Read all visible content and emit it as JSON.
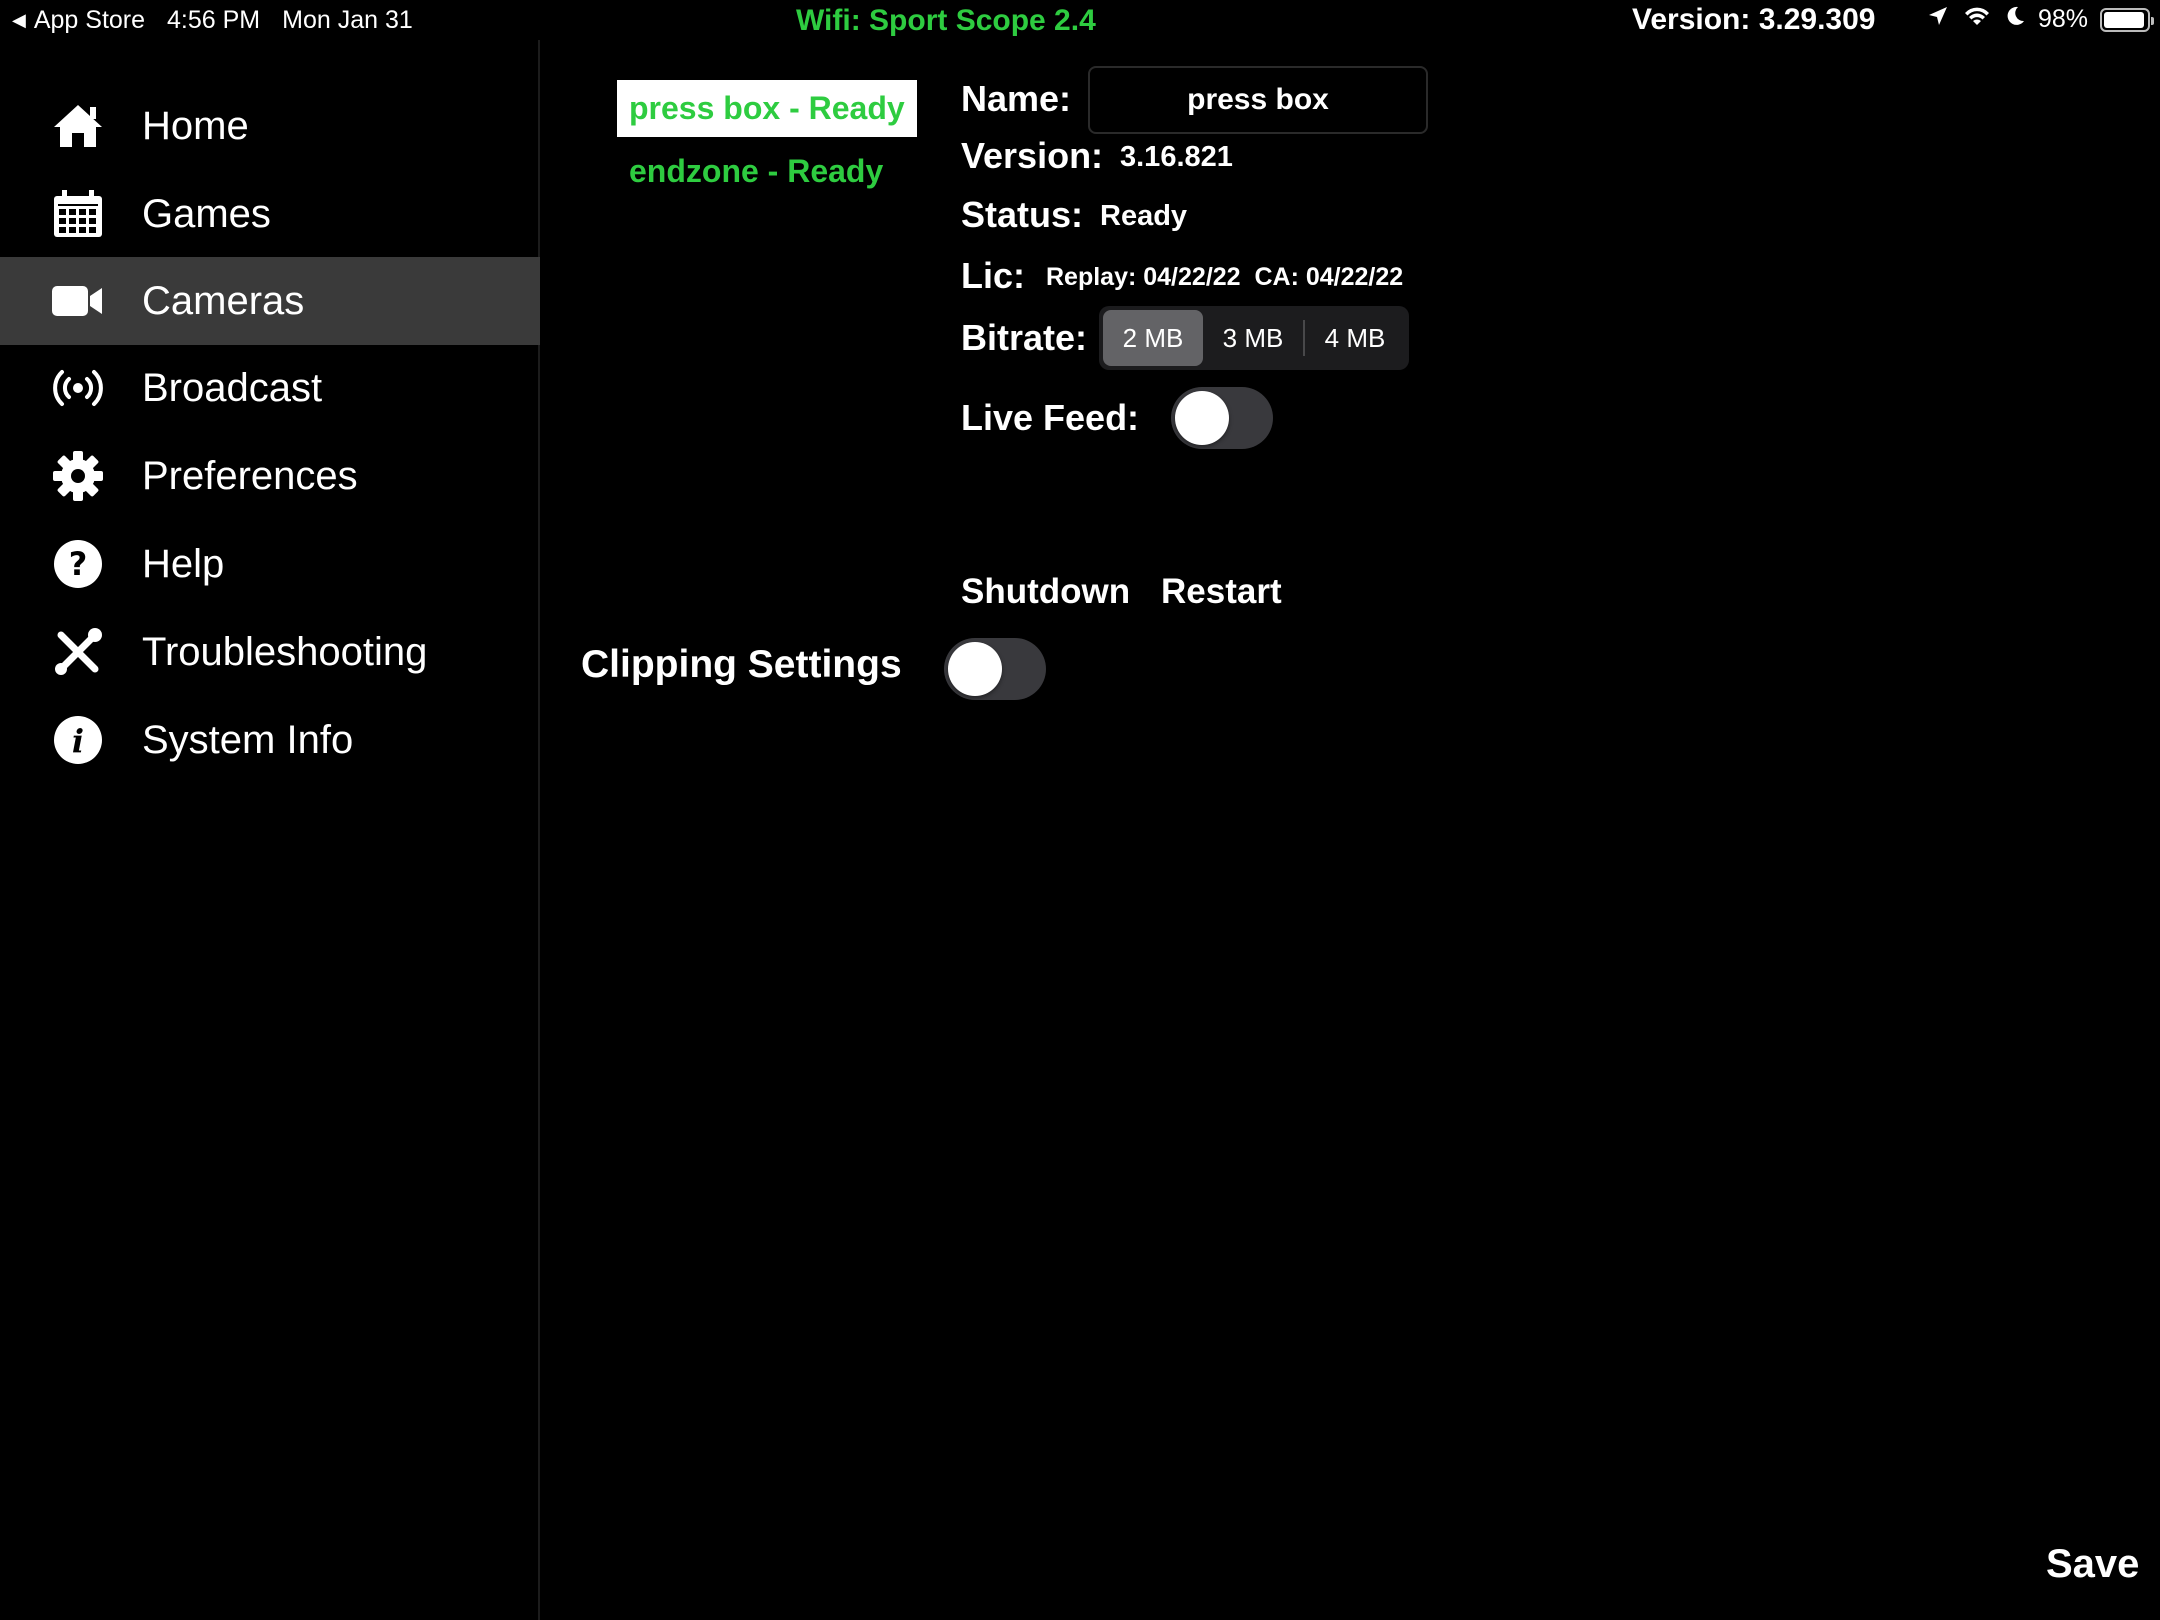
{
  "status_bar": {
    "back_app": "App Store",
    "time": "4:56 PM",
    "date": "Mon Jan 31",
    "wifi_name": "Wifi: Sport Scope 2.4",
    "version": "Version: 3.29.309",
    "battery_percent": "98%",
    "icons": [
      "location-icon",
      "wifi-icon",
      "moon-icon",
      "battery-icon"
    ]
  },
  "sidebar": {
    "items": [
      {
        "label": "Home",
        "icon": "home-icon"
      },
      {
        "label": "Games",
        "icon": "calendar-icon"
      },
      {
        "label": "Cameras",
        "icon": "video-camera-icon",
        "active": true
      },
      {
        "label": "Broadcast",
        "icon": "broadcast-icon"
      },
      {
        "label": "Preferences",
        "icon": "gear-icon"
      },
      {
        "label": "Help",
        "icon": "question-icon"
      },
      {
        "label": "Troubleshooting",
        "icon": "tools-icon"
      },
      {
        "label": "System Info",
        "icon": "info-icon"
      }
    ]
  },
  "cameras": [
    {
      "label": "press box - Ready",
      "selected": true
    },
    {
      "label": "endzone - Ready",
      "selected": false
    }
  ],
  "detail": {
    "name_label": "Name:",
    "name_value": "press box",
    "version_label": "Version:",
    "version_value": "3.16.821",
    "status_label": "Status:",
    "status_value": "Ready",
    "lic_label": "Lic:",
    "lic_value": "Replay: 04/22/22  CA: 04/22/22",
    "bitrate_label": "Bitrate:",
    "bitrate_options": [
      "2 MB",
      "3 MB",
      "4 MB"
    ],
    "bitrate_selected": "2 MB",
    "live_feed_label": "Live Feed:",
    "live_feed_on": false,
    "shutdown_label": "Shutdown",
    "restart_label": "Restart",
    "clipping_label": "Clipping Settings",
    "clipping_on": false,
    "save_label": "Save"
  },
  "colors": {
    "accent_green": "#2ecc40",
    "sidebar_active": "#3a3a3a",
    "toggle_off": "#39393d",
    "segment_selected": "#636366"
  }
}
